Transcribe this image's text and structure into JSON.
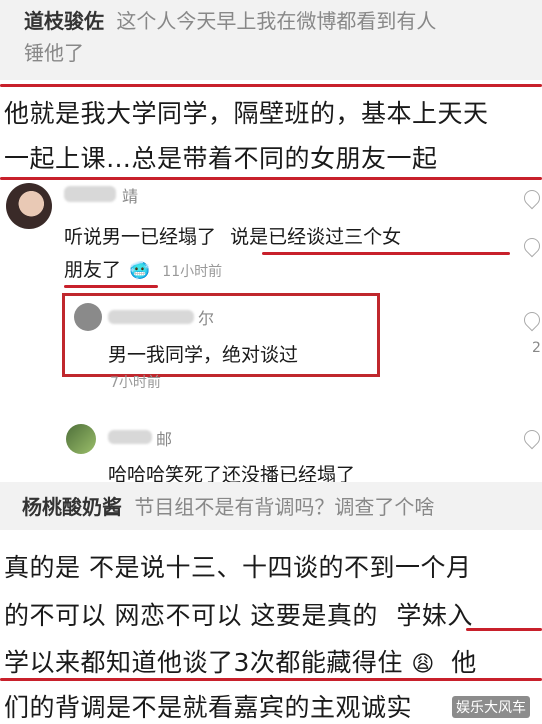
{
  "comment1": {
    "username": "道枝骏佐",
    "text_line1": "这个人今天早上我在微博都看到有人",
    "text_line2": "锤他了"
  },
  "post1": {
    "line1": "他就是我大学同学，隔壁班的，基本上天天",
    "line2": "一起上课…总是带着不同的女朋友一起"
  },
  "reply_thread": {
    "user1_name_partial": "靖",
    "comment_line1_part1": "听说男一已经塌了",
    "comment_line1_part2": "说是已经谈过三个女",
    "comment_line2": "朋友了",
    "emoji": "🥶",
    "time1": "11小时前",
    "user2_name_partial": "尔",
    "reply_text": "男一我同学，绝对谈过",
    "time2": "7小时前",
    "user3_name_partial": "邮",
    "reply3_text": "哈哈哈笑死了还没播已经塌了",
    "side_count": "2"
  },
  "comment2": {
    "username": "杨桃酸奶酱",
    "text": "节目组不是有背调吗？调查了个啥"
  },
  "post2": {
    "line1": "真的是  不是说十三、十四谈的不到一个月",
    "line2_part1": "的不可以  网恋不可以   这要是真的",
    "line2_part2": "学妹入",
    "line3_part1": "学以来都知道他谈了3次都能藏得住",
    "line3_emoji": "😩",
    "line3_part2": "他",
    "line4": "们的背调是不是就看嘉宾的主观诚实"
  },
  "watermark": "娱乐大风车",
  "colors": {
    "accent_red": "#c0272d",
    "background": "#ffffff",
    "strip": "#f2f2f2"
  }
}
